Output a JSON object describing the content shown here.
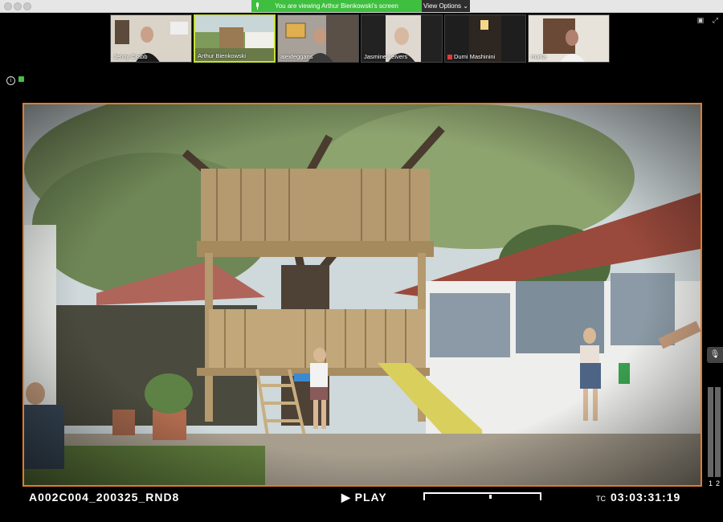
{
  "window": {
    "banner_text": "You are viewing Arthur Bienkowski's screen",
    "view_options": "View Options",
    "chevron": "⌄"
  },
  "participants": [
    {
      "name": "Jenny Crabb",
      "active": false,
      "muted": false
    },
    {
      "name": "Arthur Bienkowski",
      "active": true,
      "muted": false
    },
    {
      "name": "alexfeggans",
      "active": false,
      "muted": false
    },
    {
      "name": "Jasmine Leivers",
      "active": false,
      "muted": false
    },
    {
      "name": "Dumi Mashinini",
      "active": false,
      "muted": true
    },
    {
      "name": "maria",
      "active": false,
      "muted": false
    }
  ],
  "overlay": {
    "clip_id": "A002C004_200325_RND8",
    "play_symbol": "▶",
    "play_label": "PLAY",
    "tc_label": "TC",
    "timecode": "03:03:31:19",
    "meter_left": "1",
    "meter_right": "2",
    "progress": 0.57
  },
  "colors": {
    "banner": "#3fbf3f",
    "viewer_border": "#e27b2b",
    "active_border": "#c5e03a"
  },
  "icons": {
    "info": "i",
    "mic": "🎙"
  }
}
